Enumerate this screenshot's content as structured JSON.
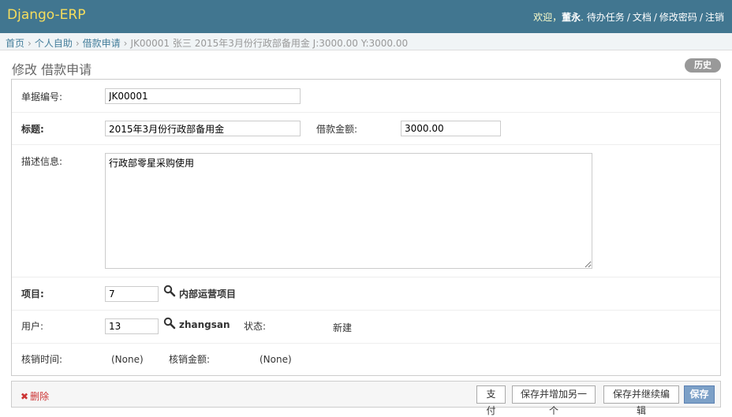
{
  "header": {
    "brand": "Django-ERP",
    "welcome": "欢迎，",
    "username": "董永",
    "todo": "待办任务",
    "docs": "文档",
    "change_password": "修改密码",
    "logout": "注销",
    "sep": "/",
    "dot": "."
  },
  "breadcrumbs": {
    "home": "首页",
    "self_service": "个人自助",
    "loan_request": "借款申请",
    "current": "JK00001 张三 2015年3月份行政部备用金 J:3000.00 Y:3000.00",
    "arrow": "›"
  },
  "page": {
    "title": "修改 借款申请",
    "history": "历史"
  },
  "form": {
    "code_label": "单据编号:",
    "code_value": "JK00001",
    "title_label": "标题:",
    "title_value": "2015年3月份行政部备用金",
    "amount_label": "借款金额:",
    "amount_value": "3000.00",
    "desc_label": "描述信息:",
    "desc_value": "行政部零星采购使用",
    "project_label": "项目:",
    "project_value": "7",
    "project_name": "内部运营项目",
    "user_label": "用户:",
    "user_value": "13",
    "user_name": "zhangsan",
    "status_label": "状态:",
    "status_value": "新建",
    "verify_time_label": "核销时间:",
    "verify_time_value": "(None)",
    "verify_amount_label": "核销金额:",
    "verify_amount_value": "(None)"
  },
  "submit": {
    "delete": "删除",
    "delete_icon": "✖",
    "pay": "支付",
    "save_add": "保存并增加另一个",
    "save_continue": "保存并继续编辑",
    "save": "保存"
  },
  "colors": {
    "header_bg": "#417690",
    "brand": "#f5dd5d",
    "breadcrumb_bg": "#f0f4f6",
    "link": "#447e9b",
    "delete": "#cc3434",
    "save_button": "#7ca0c7"
  }
}
